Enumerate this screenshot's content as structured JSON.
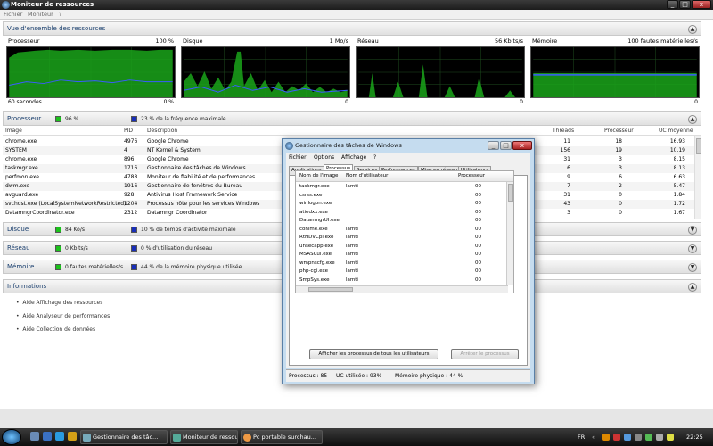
{
  "window": {
    "title": "Moniteur de ressources",
    "menu": [
      "Fichier",
      "Moniteur",
      "?"
    ]
  },
  "overview": {
    "title": "Vue d'ensemble des ressources"
  },
  "graphs": [
    {
      "label": "Processeur",
      "max": "100 %",
      "left_foot": "60 secondes",
      "right_foot": "0 %"
    },
    {
      "label": "Disque",
      "max": "1 Mo/s",
      "left_foot": "",
      "right_foot": "0"
    },
    {
      "label": "Réseau",
      "max": "56 Kbits/s",
      "left_foot": "",
      "right_foot": "0"
    },
    {
      "label": "Mémoire",
      "max": "100 fautes matérielles/s",
      "left_foot": "",
      "right_foot": "0"
    }
  ],
  "cpu_section": {
    "title": "Processeur",
    "stat1": "96 %",
    "stat2": "23 % de la fréquence maximale"
  },
  "table": {
    "headers": [
      "Image",
      "PID",
      "Description",
      "Threads",
      "Processeur",
      "UC moyenne"
    ],
    "rows": [
      [
        "chrome.exe",
        "4976",
        "Google Chrome",
        "11",
        "18",
        "16.93"
      ],
      [
        "SYSTEM",
        "4",
        "NT Kernel & System",
        "156",
        "19",
        "10.19"
      ],
      [
        "chrome.exe",
        "896",
        "Google Chrome",
        "31",
        "3",
        "8.15"
      ],
      [
        "taskmgr.exe",
        "1716",
        "Gestionnaire des tâches de Windows",
        "6",
        "3",
        "8.13"
      ],
      [
        "perfmon.exe",
        "4788",
        "Moniteur de fiabilité et de performances",
        "9",
        "6",
        "6.63"
      ],
      [
        "dwm.exe",
        "1916",
        "Gestionnaire de fenêtres du Bureau",
        "7",
        "2",
        "5.47"
      ],
      [
        "avguard.exe",
        "928",
        "Antivirus Host Framework Service",
        "31",
        "0",
        "1.84"
      ],
      [
        "svchost.exe (LocalSystemNetworkRestricted)",
        "1204",
        "Processus hôte pour les services Windows",
        "43",
        "0",
        "1.72"
      ],
      [
        "DatamngrCoordinator.exe",
        "2312",
        "Datamngr Coordinator",
        "3",
        "0",
        "1.67"
      ]
    ]
  },
  "disk_section": {
    "title": "Disque",
    "stat1": "84 Ko/s",
    "stat2": "10 % de temps d'activité maximale"
  },
  "net_section": {
    "title": "Réseau",
    "stat1": "0 Kbits/s",
    "stat2": "0 % d'utilisation du réseau"
  },
  "mem_section": {
    "title": "Mémoire",
    "stat1": "0 fautes matérielles/s",
    "stat2": "44 % de la mémoire physique utilisée"
  },
  "info_section": {
    "title": "Informations",
    "links": [
      "Aide Affichage des ressources",
      "Aide Analyseur de performances",
      "Aide Collection de données"
    ]
  },
  "taskmanager": {
    "title": "Gestionnaire des tâches de Windows",
    "menu": [
      "Fichier",
      "Options",
      "Affichage",
      "?"
    ],
    "tabs": [
      "Applications",
      "Processus",
      "Services",
      "Performances",
      "Mise en réseau",
      "Utilisateurs"
    ],
    "headers": [
      "Nom de l'image",
      "Nom d'utilisateur",
      "Processeur"
    ],
    "rows": [
      [
        "taskmgr.exe",
        "lamti",
        "00"
      ],
      [
        "csrss.exe",
        "",
        "00"
      ],
      [
        "winlogon.exe",
        "",
        "00"
      ],
      [
        "atiedxx.exe",
        "",
        "00"
      ],
      [
        "DatamngrUI.exe",
        "",
        "00"
      ],
      [
        "conime.exe",
        "lamti",
        "00"
      ],
      [
        "RtHDVCpl.exe",
        "lamti",
        "00"
      ],
      [
        "unsecapp.exe",
        "lamti",
        "00"
      ],
      [
        "MSASCui.exe",
        "lamti",
        "00"
      ],
      [
        "wmpnscfg.exe",
        "lamti",
        "00"
      ],
      [
        "php-cgi.exe",
        "lamti",
        "00"
      ],
      [
        "SmpSys.exe",
        "lamti",
        "00"
      ],
      [
        "GSTimeLineAg...",
        "lamti",
        "00"
      ],
      [
        "SynTPEnh.exe",
        "lamti",
        "00"
      ],
      [
        "realsched.exe",
        "lamti",
        "00"
      ],
      [
        "avgnt.exe",
        "lamti",
        "00"
      ]
    ],
    "show_all_button": "Afficher les processus de tous les utilisateurs",
    "end_button": "Arrêter le processus",
    "status": {
      "processes": "Processus : 85",
      "cpu": "UC utilisée : 93%",
      "memory": "Mémoire physique : 44 %"
    }
  },
  "taskbar": {
    "tasks": [
      "Gestionnaire des tâc...",
      "Moniteur de ressour...",
      "Pc portable surchau..."
    ],
    "lang": "FR",
    "clock": "22:25"
  }
}
